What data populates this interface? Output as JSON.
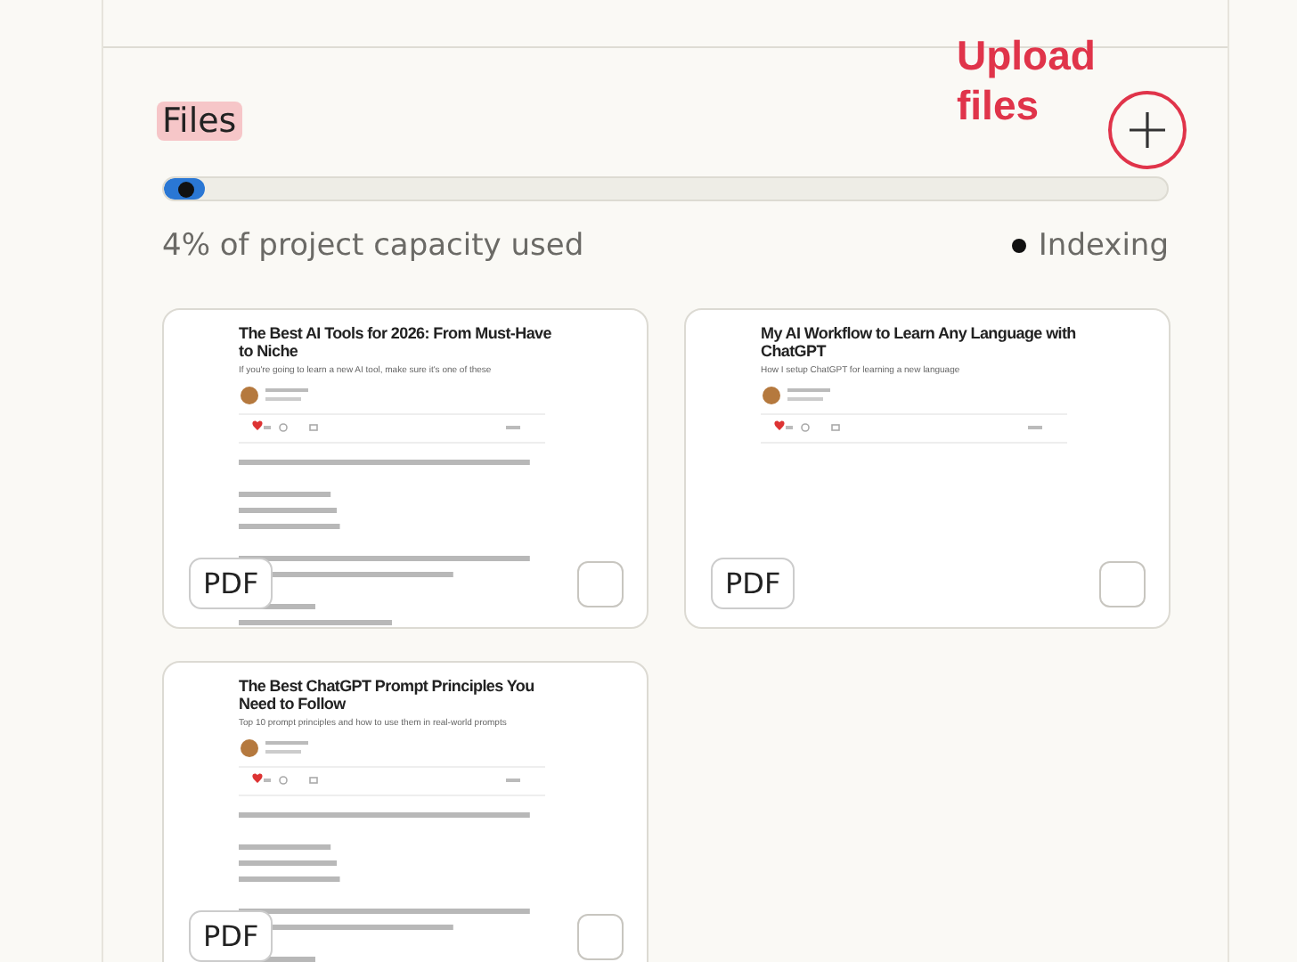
{
  "files_section": {
    "title": "Files",
    "annotation": "Upload files",
    "capacity": {
      "level": 0.04,
      "label": "4% of project capacity used"
    },
    "status": "Indexing",
    "files": [
      {
        "title": "The Best AI Tools for 2026: From Must-Have to Niche",
        "subtitle": "If you're going to learn a new AI tool, make sure it's one of these",
        "kind": "article",
        "type": "PDF",
        "selected": false
      },
      {
        "title": "My AI Workflow to Learn Any Language with ChatGPT",
        "subtitle": "How I setup ChatGPT for learning a new language",
        "kind": "header",
        "type": "PDF",
        "selected": false
      },
      {
        "title": "The Best ChatGPT Prompt Principles You Need to Follow",
        "subtitle": "Top 10 prompt principles and how to use them in real-world prompts",
        "kind": "article",
        "type": "PDF",
        "selected": false
      }
    ]
  }
}
